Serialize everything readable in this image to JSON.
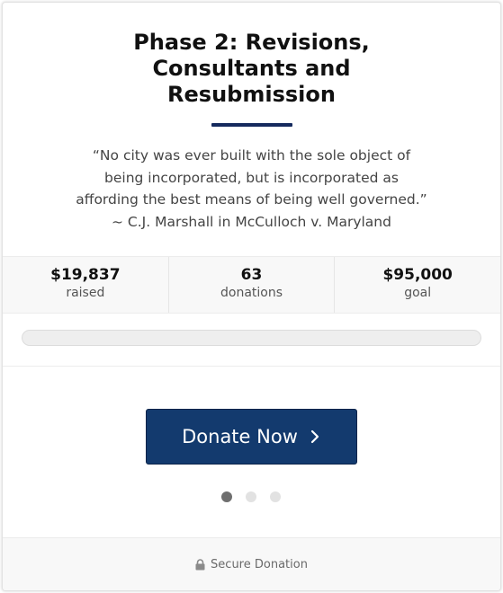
{
  "campaign": {
    "title_lines": [
      "Phase 2: Revisions,",
      "Consultants and",
      "Resubmission"
    ],
    "quote_lines": [
      "“No city was ever built with the sole object of",
      "being incorporated, but is incorporated as",
      "affording the best means of being well governed.”",
      "~ C.J. Marshall in McCulloch v. Maryland"
    ],
    "accent_color": "#152a5e"
  },
  "stats": [
    {
      "value": "$19,837",
      "label": "raised"
    },
    {
      "value": "63",
      "label": "donations"
    },
    {
      "value": "$95,000",
      "label": "goal"
    }
  ],
  "progress": {
    "fraction": 0
  },
  "donate": {
    "label": "Donate Now",
    "icon": "chevron-right-icon",
    "color": "#133a6e"
  },
  "carousel": {
    "active_index": 0,
    "count": 3
  },
  "footer": {
    "icon": "lock-icon",
    "text": "Secure Donation"
  }
}
